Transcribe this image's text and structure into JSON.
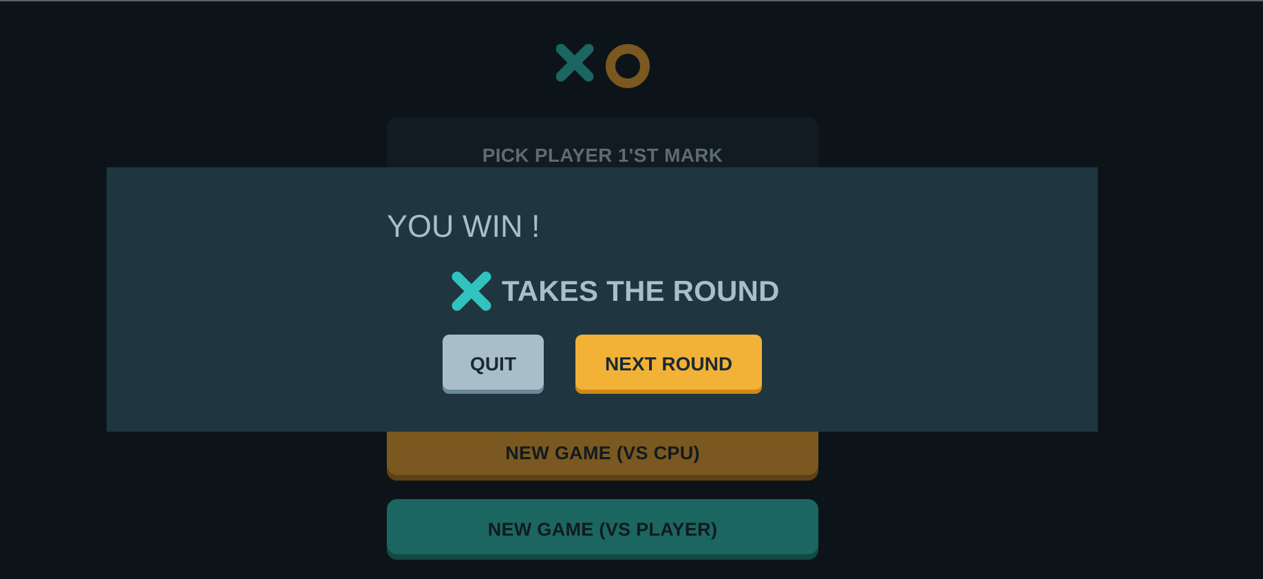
{
  "logo": {
    "icons": [
      "x-mark-icon",
      "o-mark-icon"
    ],
    "x_color": "#1b6660",
    "o_color": "#7a581f"
  },
  "menu": {
    "pick_title": "PICK PLAYER 1'ST MARK",
    "new_game_cpu_label": "NEW GAME (VS CPU)",
    "new_game_player_label": "NEW GAME (VS PLAYER)",
    "cpu_color": "#7a581f",
    "player_color": "#1b6660"
  },
  "modal": {
    "title": "YOU WIN !",
    "winner_icon": "x-mark-icon",
    "winner_color": "#31c3bd",
    "round_text": "TAKES THE ROUND",
    "quit_label": "QUIT",
    "next_round_label": "NEXT ROUND",
    "quit_color": "#a8bfc9",
    "next_round_color": "#f2b137",
    "background_color": "#1f3540"
  }
}
